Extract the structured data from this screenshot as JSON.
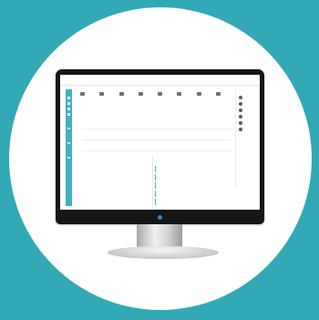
{
  "colors": {
    "background": "#33a9b6",
    "accent": "#3fb2bf",
    "monitor_bezel": "#161616",
    "power_led": "#2c86c9"
  },
  "app": {
    "logo_text": "",
    "user_label": ""
  },
  "header": {
    "nav": [
      "",
      "",
      "",
      ""
    ]
  },
  "quick_access": [
    {
      "icon": "mail-icon",
      "label": "",
      "count": ""
    },
    {
      "icon": "calendar-icon",
      "label": "",
      "count": ""
    },
    {
      "icon": "document-icon",
      "label": "",
      "count": ""
    },
    {
      "icon": "clock-icon",
      "label": "",
      "count": ""
    },
    {
      "icon": "chart-icon",
      "label": "",
      "count": ""
    },
    {
      "icon": "building-icon",
      "label": "",
      "count": ""
    },
    {
      "icon": "grid-icon",
      "label": "",
      "count": ""
    },
    {
      "icon": "people-icon",
      "label": "",
      "count": ""
    }
  ],
  "tabs": [
    "",
    "",
    ""
  ],
  "notices": [
    {
      "date": "",
      "title": "",
      "meta": ""
    },
    {
      "date": "",
      "title": "",
      "meta": ""
    },
    {
      "date": "",
      "title": "",
      "meta": ""
    }
  ],
  "people_panel": {
    "title": "",
    "people": [
      "",
      "",
      "",
      "",
      "",
      ""
    ]
  },
  "calendar": {
    "title": "",
    "weekdays": [
      "",
      "",
      "",
      "",
      "",
      "",
      ""
    ],
    "rows": [
      [
        "",
        "",
        "",
        "",
        "",
        "",
        ""
      ],
      [
        "",
        "",
        "",
        "",
        "",
        "",
        ""
      ],
      [
        "",
        "",
        "",
        "",
        "",
        "",
        ""
      ],
      [
        "",
        "",
        "",
        "",
        "",
        "",
        ""
      ],
      [
        "",
        "",
        "",
        "",
        "",
        "",
        ""
      ]
    ]
  },
  "schedule": {
    "title": "",
    "items": [
      {
        "time": "",
        "text": ""
      },
      {
        "time": "",
        "text": ""
      },
      {
        "time": "",
        "text": ""
      },
      {
        "time": "",
        "text": ""
      },
      {
        "time": "",
        "text": ""
      }
    ]
  }
}
